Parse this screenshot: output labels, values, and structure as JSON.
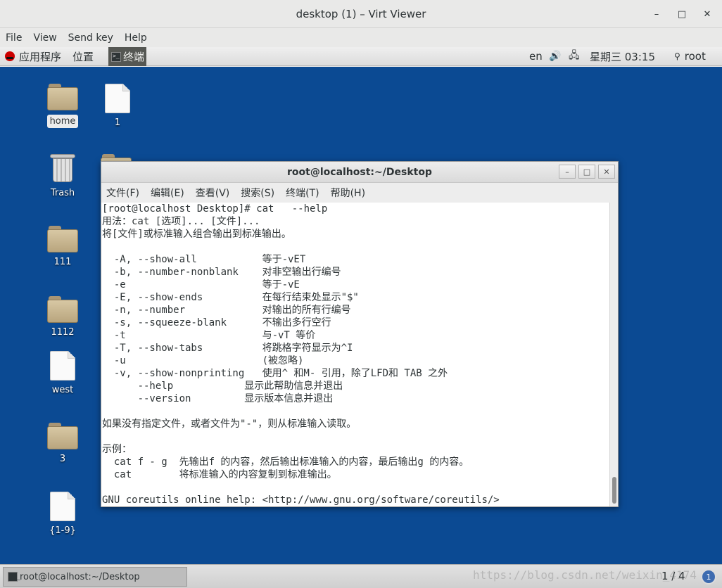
{
  "viewer": {
    "title": "desktop (1) – Virt Viewer",
    "menu": [
      "File",
      "View",
      "Send key",
      "Help"
    ],
    "controls": {
      "minimize": "–",
      "maximize": "□",
      "close": "✕"
    }
  },
  "top_panel": {
    "apps": "应用程序",
    "places": "位置",
    "terminal_task": "终端",
    "lang": "en",
    "clock": "星期三 03:15",
    "user": "root"
  },
  "desktop_icons": [
    {
      "label": "home",
      "type": "folder-home"
    },
    {
      "label": "1",
      "type": "file"
    },
    {
      "label": "Trash",
      "type": "trash"
    },
    {
      "label": "111",
      "type": "folder"
    },
    {
      "label": "1112",
      "type": "folder"
    },
    {
      "label": "west",
      "type": "file"
    },
    {
      "label": "3",
      "type": "folder"
    },
    {
      "label": "{1-9}",
      "type": "file"
    }
  ],
  "terminal": {
    "title": "root@localhost:~/Desktop",
    "menu": [
      "文件(F)",
      "编辑(E)",
      "查看(V)",
      "搜索(S)",
      "终端(T)",
      "帮助(H)"
    ],
    "lines": [
      "[root@localhost Desktop]# cat   --help",
      "用法：cat [选项]... [文件]...",
      "将[文件]或标准输入组合输出到标准输出。",
      "",
      "  -A, --show-all           等于-vET",
      "  -b, --number-nonblank    对非空输出行编号",
      "  -e                       等于-vE",
      "  -E, --show-ends          在每行结束处显示\"$\"",
      "  -n, --number             对输出的所有行编号",
      "  -s, --squeeze-blank      不输出多行空行",
      "  -t                       与-vT 等价",
      "  -T, --show-tabs          将跳格字符显示为^I",
      "  -u                       (被忽略)",
      "  -v, --show-nonprinting   使用^ 和M- 引用，除了LFD和 TAB 之外",
      "      --help            显示此帮助信息并退出",
      "      --version         显示版本信息并退出",
      "",
      "如果没有指定文件，或者文件为\"-\"，则从标准输入读取。",
      "",
      "示例：",
      "  cat f - g  先输出f 的内容，然后输出标准输入的内容，最后输出g 的内容。",
      "  cat        将标准输入的内容复制到标准输出。",
      "",
      "GNU coreutils online help: <http://www.gnu.org/software/coreutils/>"
    ]
  },
  "bottom_panel": {
    "task": "root@localhost:~/Desktop",
    "watermark": "https://blog.csdn.net/weixin_4174",
    "workspace": "1 / 4",
    "notifications": "1"
  }
}
